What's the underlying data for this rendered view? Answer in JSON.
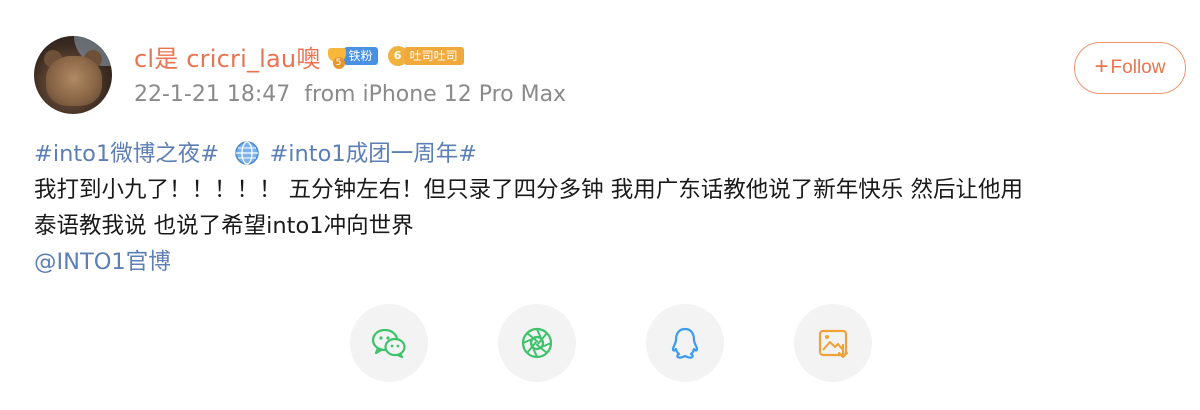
{
  "post": {
    "username": "cl是 cricri_lau噢",
    "fan_level": "5",
    "fan_badge_label": "铁粉",
    "group_badge_icon": "6",
    "group_badge_label": "吐司吐司",
    "timestamp": "22-1-21 18:47",
    "source": "from iPhone 12 Pro Max",
    "follow_label": "Follow",
    "follow_plus": "+",
    "hashtag1": "#into1微博之夜#",
    "hashtag2": "#into1成团一周年#",
    "text_line1": "我打到小九了！！！！！ 五分钟左右！但只录了四分多钟 我用广东话教他说了新年快乐 然后让他用",
    "text_line2": "泰语教我说 也说了希望into1冲向世界",
    "mention": "@INTO1官博"
  },
  "share": [
    {
      "name": "wechat-icon",
      "color": "#3ec26b"
    },
    {
      "name": "moments-icon",
      "color": "#3ec26b"
    },
    {
      "name": "qq-icon",
      "color": "#3a9cf0"
    },
    {
      "name": "save-image-icon",
      "color": "#f0a23a"
    }
  ],
  "colors": {
    "accent": "#eb7350",
    "link": "#5d7fb5",
    "meta": "#8a8a8a"
  }
}
